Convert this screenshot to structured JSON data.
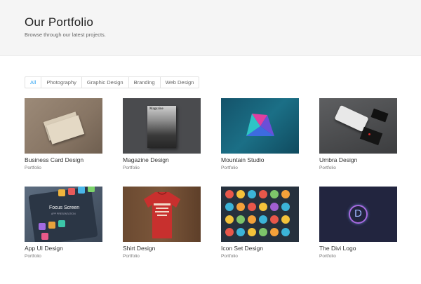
{
  "header": {
    "title": "Our Portfolio",
    "subtitle": "Browse through our latest projects."
  },
  "filters": [
    {
      "label": "All",
      "active": true
    },
    {
      "label": "Photography",
      "active": false
    },
    {
      "label": "Graphic Design",
      "active": false
    },
    {
      "label": "Branding",
      "active": false
    },
    {
      "label": "Web Design",
      "active": false
    }
  ],
  "projects": [
    {
      "title": "Business Card Design",
      "category": "Portfolio"
    },
    {
      "title": "Magazine Design",
      "category": "Portfolio"
    },
    {
      "title": "Mountain Studio",
      "category": "Portfolio"
    },
    {
      "title": "Umbra Design",
      "category": "Portfolio"
    },
    {
      "title": "App UI Design",
      "category": "Portfolio"
    },
    {
      "title": "Shirt Design",
      "category": "Portfolio"
    },
    {
      "title": "Icon Set Design",
      "category": "Portfolio"
    },
    {
      "title": "The Divi Logo",
      "category": "Portfolio"
    }
  ],
  "thumb_text": {
    "magazine_masthead": "Magazine",
    "app_screen_title": "Focus Screen",
    "app_screen_sub": "APP PRESENTATION",
    "shirt_print": "MOCKUP",
    "divi_letter": "D"
  },
  "colors": {
    "accent": "#2ea3f2",
    "header_bg": "#f5f5f5"
  }
}
